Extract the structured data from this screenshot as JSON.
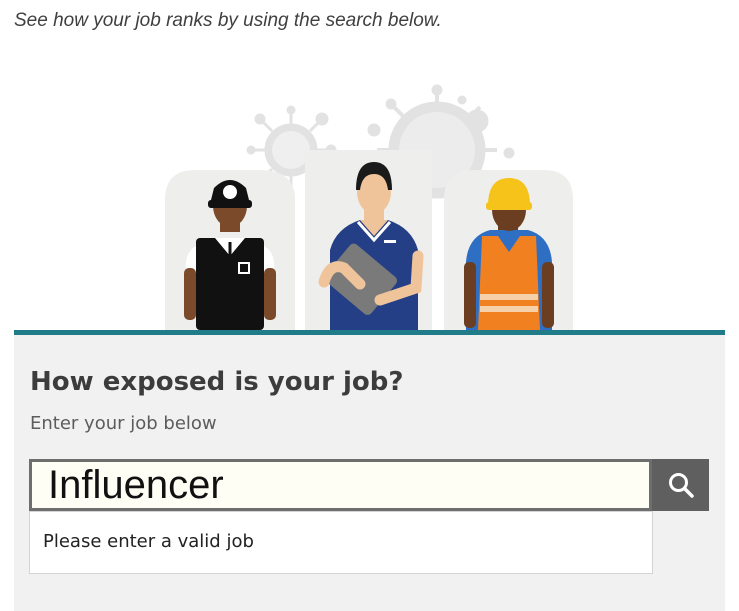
{
  "intro_text": "See how your job ranks by using the search below.",
  "illustration": {
    "figures": [
      "police-officer",
      "nurse",
      "construction-worker"
    ],
    "virus_color": "#e2e2e2",
    "card_color": "#eeeeec"
  },
  "panel": {
    "accent_color": "#1f7c88",
    "heading": "How exposed is your job?",
    "sublabel": "Enter your job below",
    "search": {
      "value": "Influencer",
      "placeholder": ""
    },
    "search_icon": "search-icon",
    "error_message": "Please enter a valid job"
  }
}
